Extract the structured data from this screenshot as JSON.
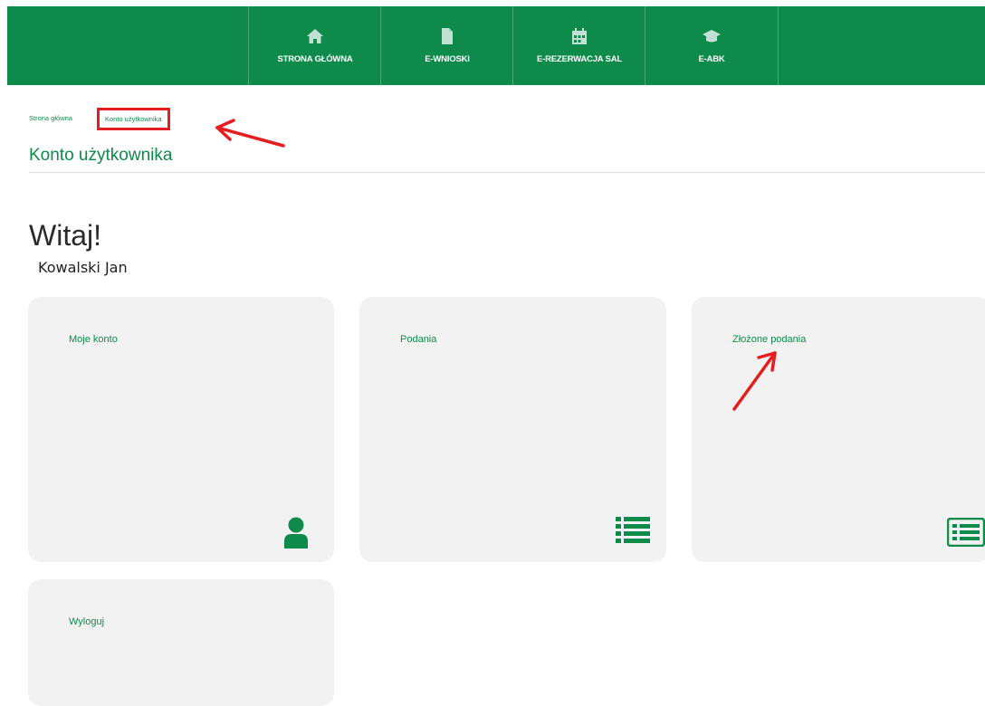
{
  "nav": {
    "items": [
      {
        "label": "STRONA GŁÓWNA",
        "icon": "home-icon"
      },
      {
        "label": "E-WNIOSKI",
        "icon": "document-icon"
      },
      {
        "label": "E-REZERWACJA SAL",
        "icon": "calendar-icon"
      },
      {
        "label": "E-ABK",
        "icon": "graduation-cap-icon"
      }
    ]
  },
  "breadcrumb": {
    "home": "Strona główna",
    "current": "Konto użytkownika"
  },
  "page": {
    "title": "Konto użytkownika",
    "welcome": "Witaj!",
    "user_name": "Kowalski Jan"
  },
  "cards": [
    {
      "title": "Moje konto",
      "icon": "user-icon"
    },
    {
      "title": "Podania",
      "icon": "list-icon"
    },
    {
      "title": "Złożone podania",
      "icon": "list-alt-icon"
    },
    {
      "title": "Wyloguj",
      "icon": "logout-icon"
    }
  ],
  "colors": {
    "brand_green": "#0e8a4b",
    "card_bg": "#f2f2f2",
    "annotation_red": "#e41e20"
  }
}
